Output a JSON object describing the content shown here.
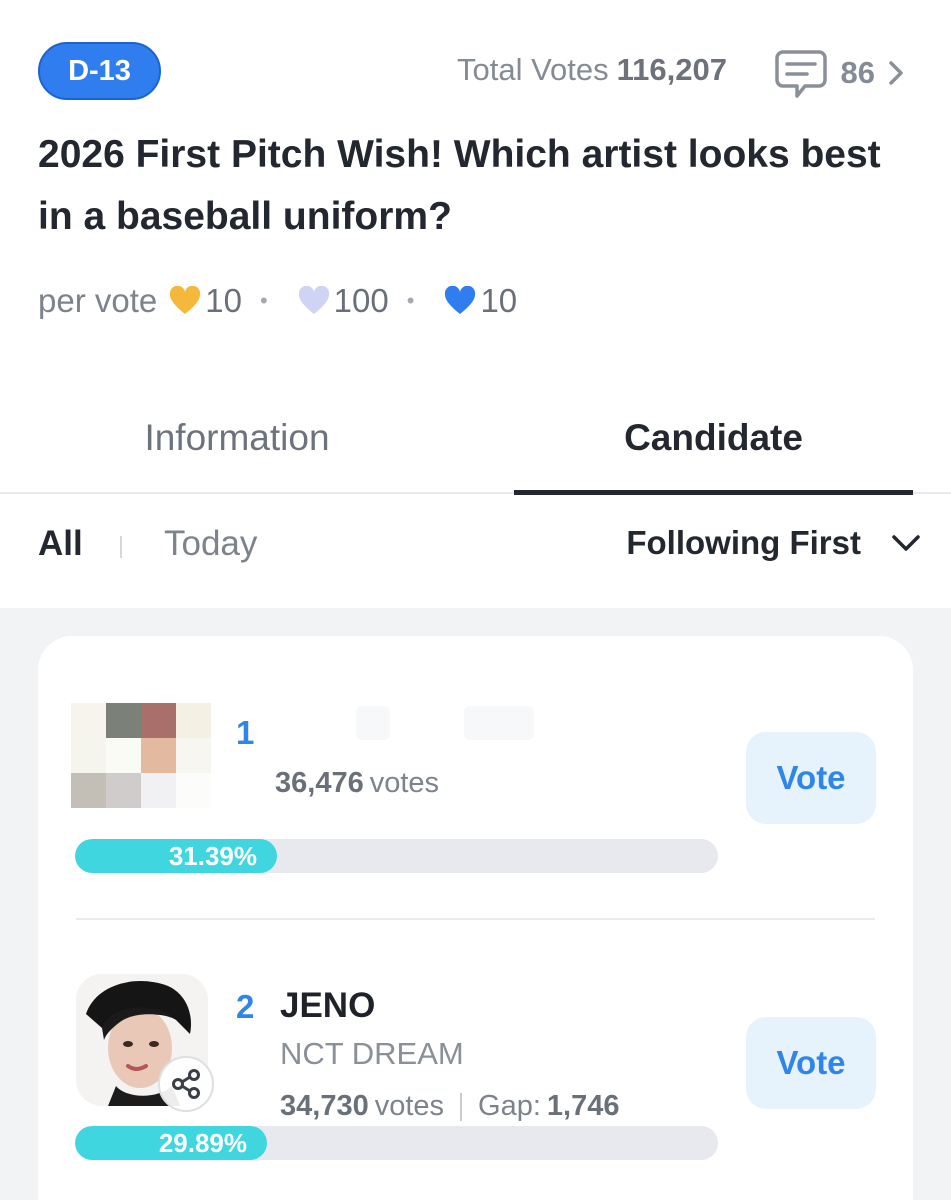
{
  "header": {
    "dday_badge": "D-13",
    "total_votes_label": "Total Votes",
    "total_votes_value": "116,207",
    "comments_count": "86",
    "title": "2026 First Pitch Wish! Which artist looks best in a baseball uniform?",
    "per_vote_label": "per vote",
    "costs": [
      {
        "icon": "gold-heart-icon",
        "color": "#f5b83a",
        "amount": "10"
      },
      {
        "icon": "lavender-heart-icon",
        "color": "#cfd3f4",
        "amount": "100"
      },
      {
        "icon": "blue-heart-icon",
        "color": "#2f7dee",
        "amount": "10"
      }
    ],
    "separator": "•"
  },
  "tabs": {
    "information": "Information",
    "candidate": "Candidate",
    "active": "Candidate"
  },
  "filters": {
    "all": "All",
    "today": "Today",
    "sort_label": "Following First",
    "active": "All"
  },
  "candidates": [
    {
      "rank": "1",
      "name": "",
      "group": "",
      "votes": "36,476",
      "votes_suffix": "votes",
      "gap_label": "",
      "gap": "",
      "percent_label": "31.39%",
      "percent": 31.39,
      "vote_button": "Vote",
      "thumbnail": "pixelated-hidden-photo"
    },
    {
      "rank": "2",
      "name": "JENO",
      "group": "NCT DREAM",
      "votes": "34,730",
      "votes_suffix": "votes",
      "gap_label": "Gap:",
      "gap": "1,746",
      "percent_label": "29.89%",
      "percent": 29.89,
      "vote_button": "Vote",
      "thumbnail": "artist-photo"
    }
  ],
  "colors": {
    "accent_blue": "#2f86e8",
    "badge_blue": "#2f7dee",
    "progress_fill": "#3fd6e0",
    "progress_track": "#e7e9ee",
    "vote_button_bg": "#e6f3fd"
  }
}
